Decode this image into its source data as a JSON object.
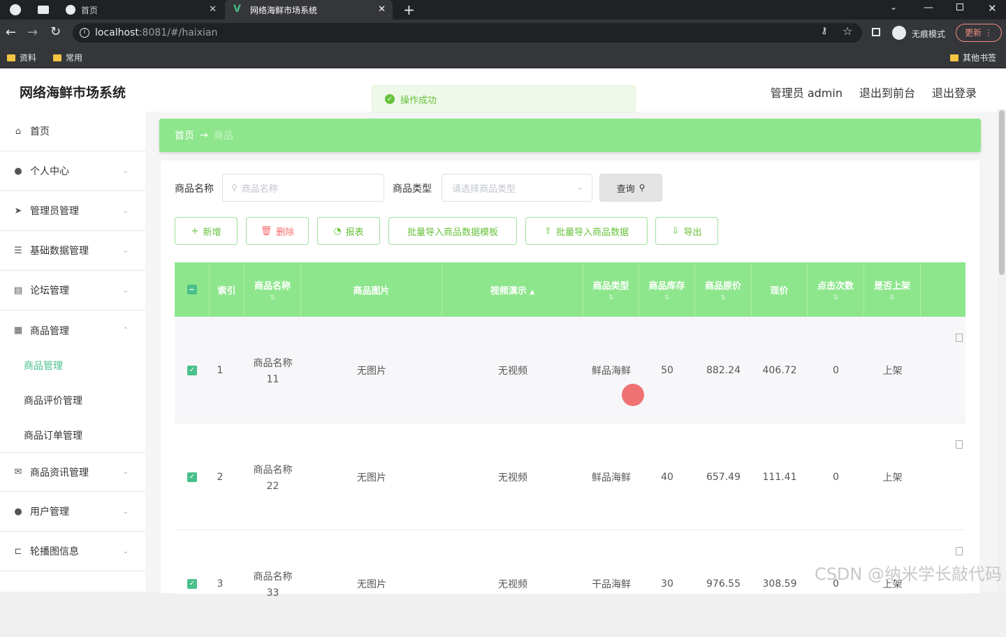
{
  "browser": {
    "tabs": [
      {
        "label": "首页"
      },
      {
        "label": "网络海鲜市场系统"
      }
    ],
    "url_host": "localhost",
    "url_rest": ":8081/#/haixian",
    "incognito_label": "无痕模式",
    "update_label": "更新",
    "bookmarks": [
      "资料",
      "常用"
    ],
    "other_bookmarks": "其他书签"
  },
  "app": {
    "title": "网络海鲜市场系统",
    "top_links": [
      "管理员 admin",
      "退出到前台",
      "退出登录"
    ],
    "toast": "操作成功"
  },
  "sidebar": {
    "items": [
      {
        "label": "首页",
        "icon": "home-icon"
      },
      {
        "label": "个人中心",
        "icon": "user-icon"
      },
      {
        "label": "管理员管理",
        "icon": "send-icon"
      },
      {
        "label": "基础数据管理",
        "icon": "sliders-icon"
      },
      {
        "label": "论坛管理",
        "icon": "document-icon"
      },
      {
        "label": "商品管理",
        "icon": "grid-icon"
      }
    ],
    "sub_items": [
      "商品管理",
      "商品评价管理",
      "商品订单管理"
    ],
    "items_after": [
      {
        "label": "商品资讯管理",
        "icon": "mail-icon"
      },
      {
        "label": "用户管理",
        "icon": "balloon-icon"
      },
      {
        "label": "轮播图信息",
        "icon": "crop-icon"
      }
    ]
  },
  "breadcrumb": {
    "home": "首页",
    "arrow": "→",
    "current": "商品"
  },
  "search": {
    "name_label": "商品名称",
    "name_placeholder": "商品名称",
    "type_label": "商品类型",
    "type_placeholder": "请选择商品类型",
    "query_button": "查询"
  },
  "actions": [
    "新增",
    "删除",
    "报表",
    "批量导入商品数据模板",
    "批量导入商品数据",
    "导出"
  ],
  "table": {
    "headers": [
      "索引",
      "商品名称",
      "商品图片",
      "视频演示",
      "商品类型",
      "商品库存",
      "商品原价",
      "现价",
      "点击次数",
      "是否上架"
    ],
    "rows": [
      {
        "index": "1",
        "name": "商品名称",
        "name2": "11",
        "image": "无图片",
        "video": "无视频",
        "type": "鲜品海鲜",
        "stock": "50",
        "original_price": "882.24",
        "price": "406.72",
        "clicks": "0",
        "listed": "上架"
      },
      {
        "index": "2",
        "name": "商品名称",
        "name2": "22",
        "image": "无图片",
        "video": "无视频",
        "type": "鲜品海鲜",
        "stock": "40",
        "original_price": "657.49",
        "price": "111.41",
        "clicks": "0",
        "listed": "上架"
      },
      {
        "index": "3",
        "name": "商品名称",
        "name2": "33",
        "image": "无图片",
        "video": "无视频",
        "type": "干品海鲜",
        "stock": "30",
        "original_price": "976.55",
        "price": "308.59",
        "clicks": "0",
        "listed": "上架"
      }
    ]
  },
  "watermark": "CSDN @纳米学长敲代码"
}
